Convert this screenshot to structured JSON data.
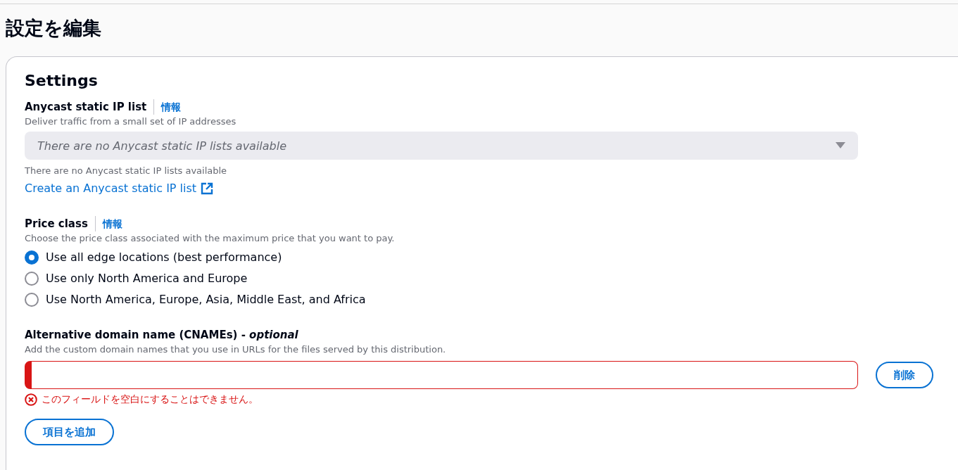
{
  "page": {
    "title": "設定を編集"
  },
  "settings": {
    "heading": "Settings",
    "anycast": {
      "label": "Anycast static IP list",
      "info": "情報",
      "description": "Deliver traffic from a small set of IP addresses",
      "select": {
        "placeholder": "There are no Anycast static IP lists available",
        "disabled": true
      },
      "hint": "There are no Anycast static IP lists available",
      "link": "Create an Anycast static IP list"
    },
    "price_class": {
      "label": "Price class",
      "info": "情報",
      "description": "Choose the price class associated with the maximum price that you want to pay.",
      "options": [
        {
          "label": "Use all edge locations (best performance)",
          "selected": true
        },
        {
          "label": "Use only North America and Europe",
          "selected": false
        },
        {
          "label": "Use North America, Europe, Asia, Middle East, and Africa",
          "selected": false
        }
      ]
    },
    "cnames": {
      "label": "Alternative domain name (CNAMEs) - *optional*",
      "description": "Add the custom domain names that you use in URLs for the files served by this distribution.",
      "items": [
        {
          "invalid": true,
          "error": "このフィールドを空白にすることはできません。",
          "remove_button": "削除"
        }
      ],
      "add_button": "項目を追加"
    }
  }
}
